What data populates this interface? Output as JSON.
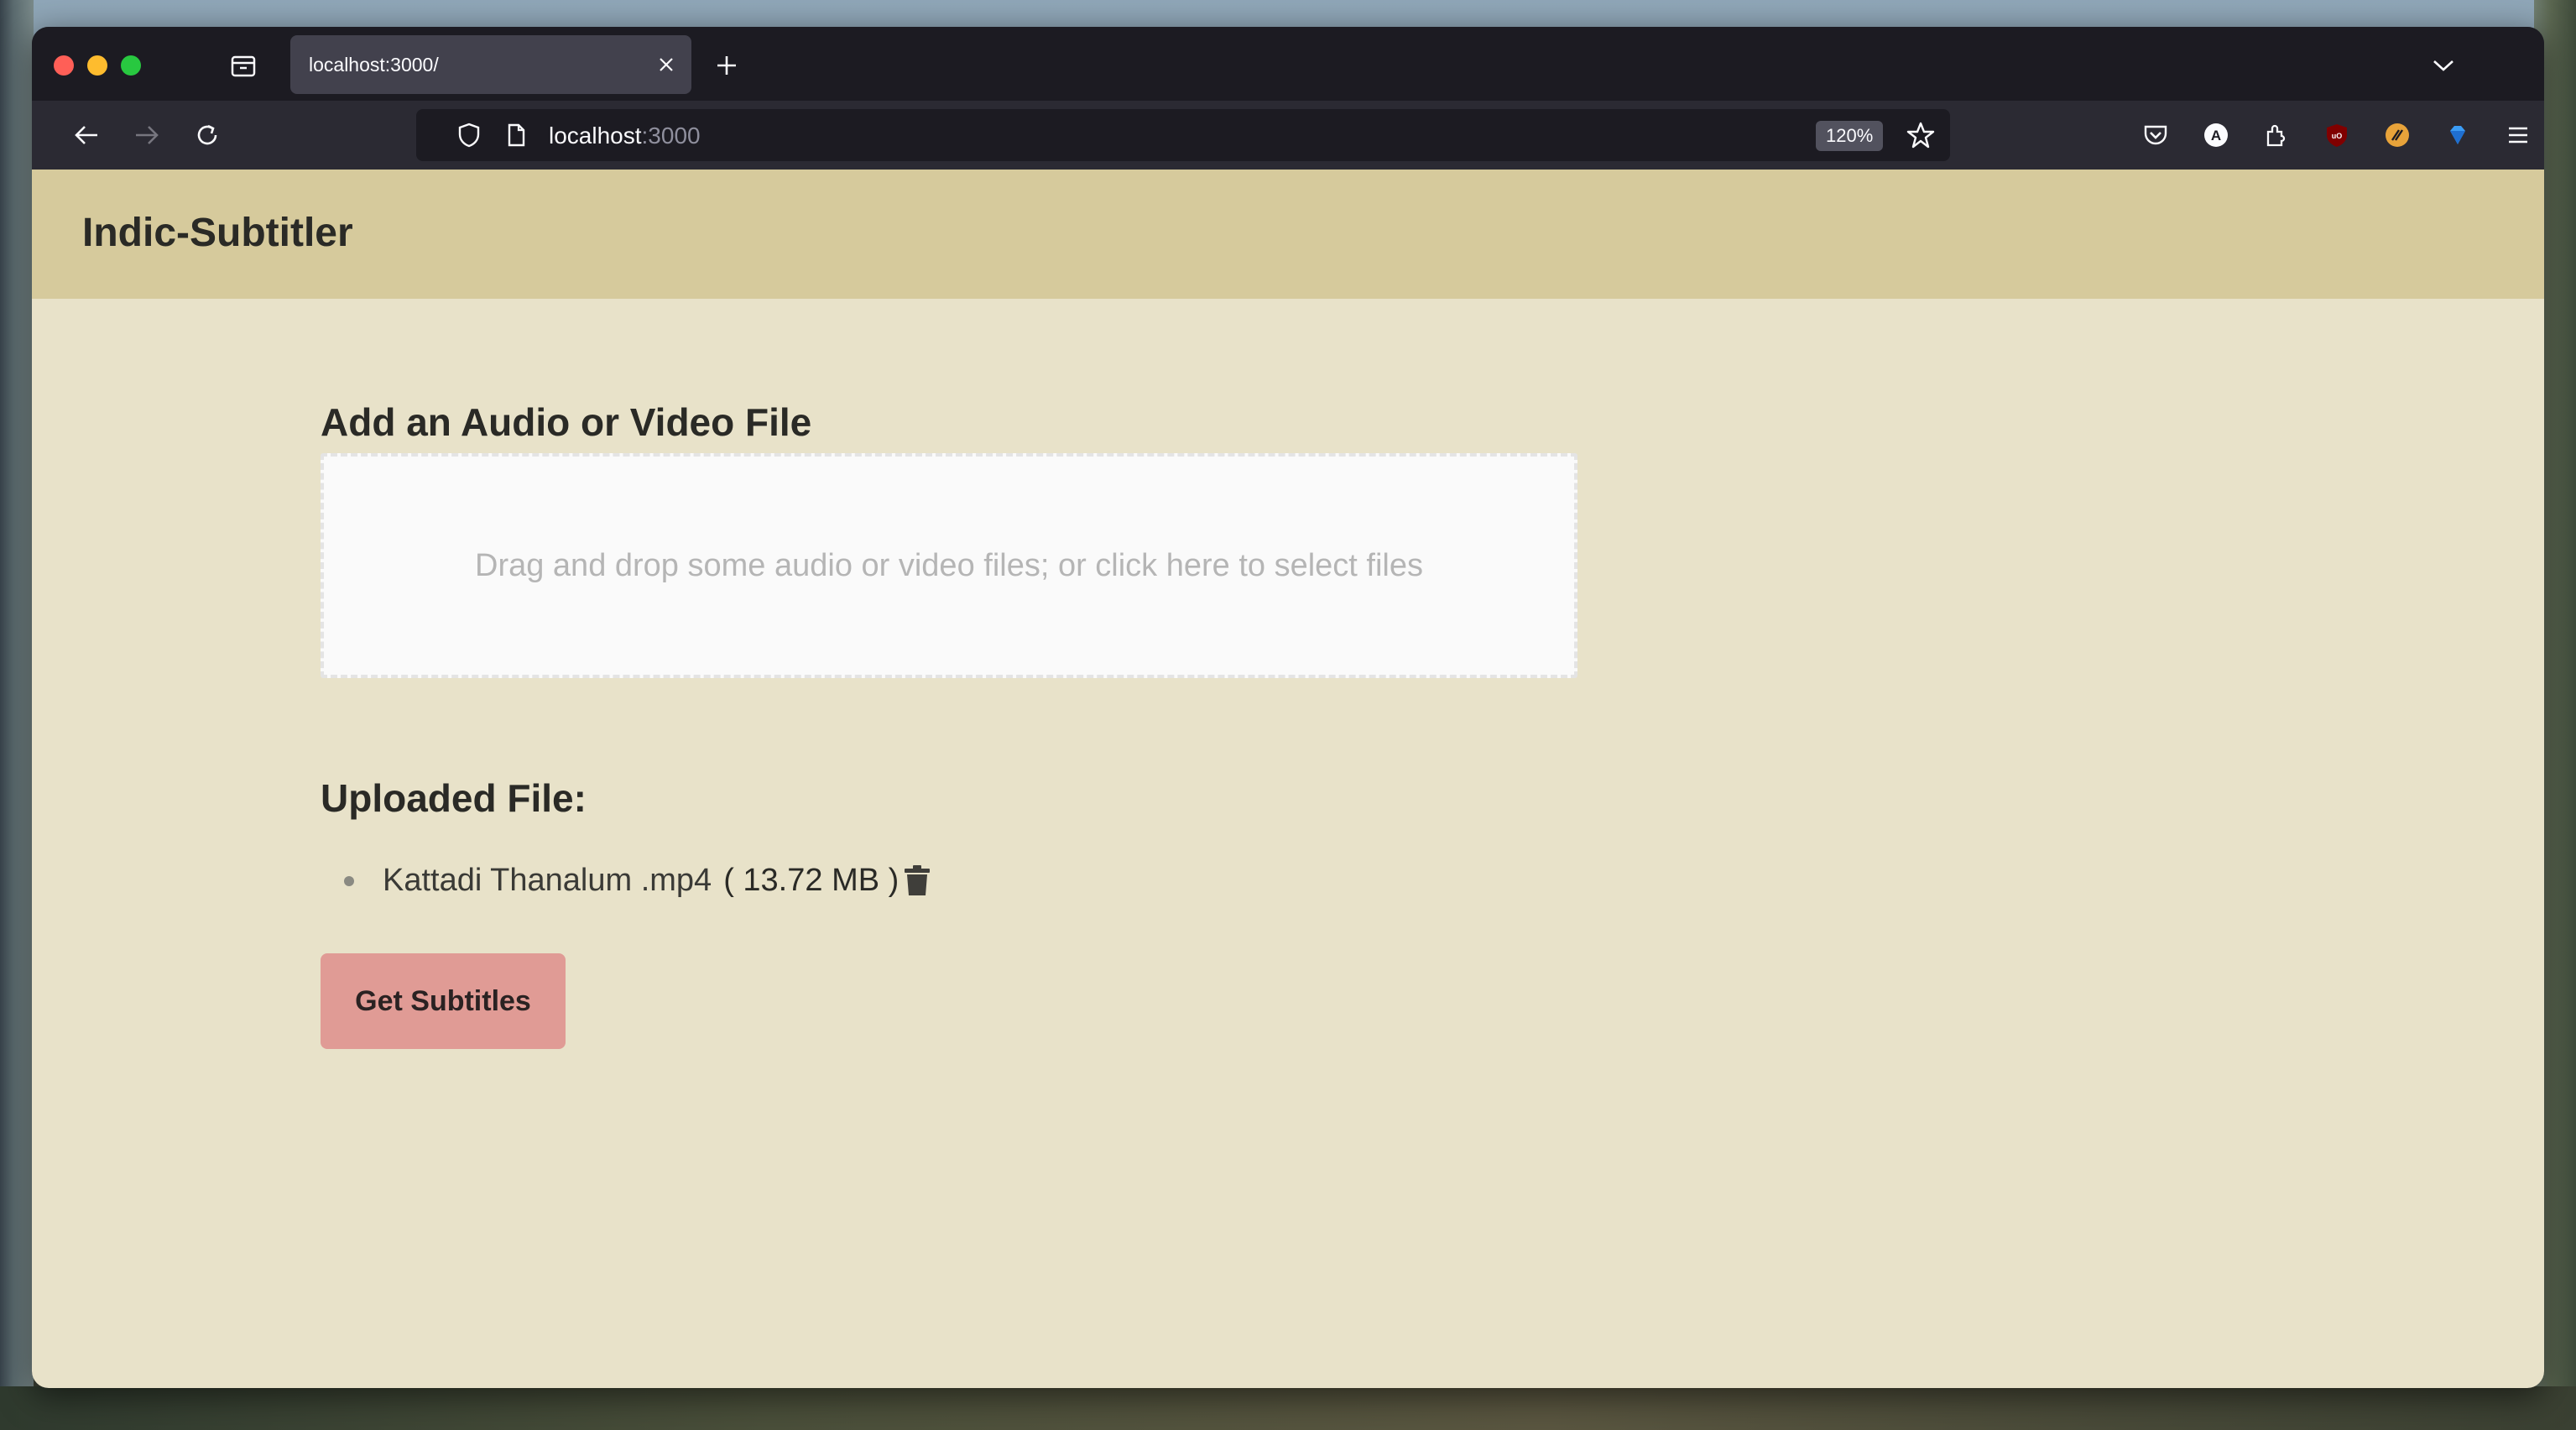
{
  "browser": {
    "tab_title": "localhost:3000/",
    "url_host": "localhost",
    "url_port": ":3000",
    "zoom": "120%"
  },
  "app": {
    "title": "Indic-Subtitler"
  },
  "upload": {
    "heading": "Add an Audio or Video File",
    "dropzone_text": "Drag and drop some audio or video files; or click here to select files"
  },
  "uploaded": {
    "heading": "Uploaded File:",
    "files": [
      {
        "name": "Kattadi Thanalum .mp4",
        "size": "( 13.72 MB )"
      }
    ]
  },
  "actions": {
    "get_subtitles_label": "Get Subtitles"
  },
  "colors": {
    "header_bg": "#d6ca9c",
    "page_bg": "#e8e2c9",
    "button_bg": "#e09b95"
  }
}
